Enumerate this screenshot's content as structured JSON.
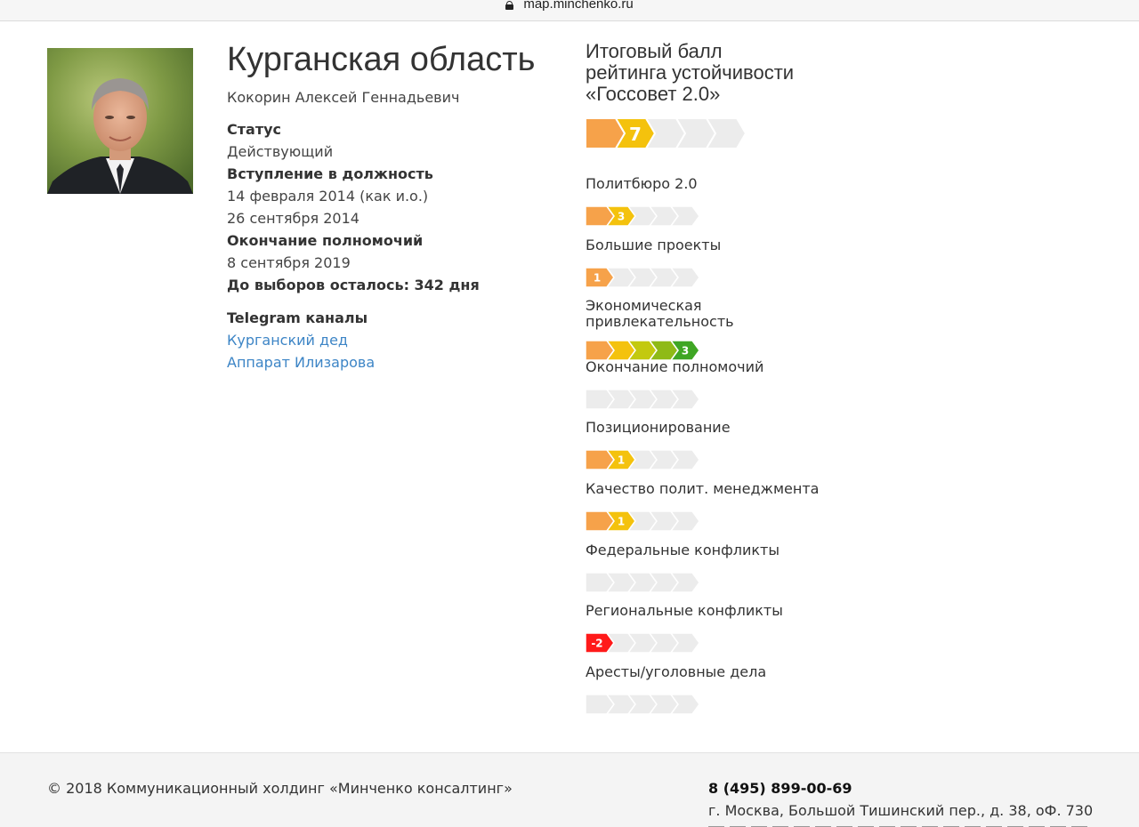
{
  "browser": {
    "url": "map.minchenko.ru"
  },
  "region": {
    "title": "Курганская область",
    "governor": "Кокорин Алексей Геннадьевич",
    "status_label": "Статус",
    "status_value": "Действующий",
    "start_label": "Вступление в должность",
    "start_value_1": "14 февраля 2014 (как и.о.)",
    "start_value_2": "26 сентября 2014",
    "end_label": "Окончание полномочий",
    "end_value": "8 сентября 2019",
    "elections_left": "До выборов осталось: 342 дня",
    "telegram_label": "Telegram каналы",
    "telegram_links": [
      "Курганский дед",
      "Аппарат Илизарова"
    ]
  },
  "total": {
    "title_lines": [
      "Итоговый балл",
      "рейтинга устойчивости",
      "«Госсовет 2.0»"
    ],
    "score": "7",
    "filled": 2
  },
  "criteria": [
    {
      "label": [
        "Политбюро 2.0"
      ],
      "score": "3",
      "filled": 2,
      "colors": [
        "#f6a24a",
        "#f4c20d"
      ]
    },
    {
      "label": [
        "Большие проекты"
      ],
      "score": "1",
      "filled": 1,
      "colors": [
        "#f6a24a"
      ]
    },
    {
      "label": [
        "Экономическая",
        "привлекательность"
      ],
      "score": "3",
      "filled": 5,
      "colors": [
        "#f6a24a",
        "#f4c20d",
        "#c3c90f",
        "#8fba17",
        "#3fa624"
      ]
    },
    {
      "label": [
        "Окончание полномочий"
      ],
      "score": "",
      "filled": 0,
      "colors": []
    },
    {
      "label": [
        "Позиционирование"
      ],
      "score": "1",
      "filled": 2,
      "colors": [
        "#f6a24a",
        "#f4c20d"
      ]
    },
    {
      "label": [
        "Качество полит. менеджмента"
      ],
      "score": "1",
      "filled": 2,
      "colors": [
        "#f6a24a",
        "#f4c20d"
      ]
    },
    {
      "label": [
        "Федеральные конфликты"
      ],
      "score": "",
      "filled": 0,
      "colors": []
    },
    {
      "label": [
        "Региональные конфликты"
      ],
      "score": "-2",
      "filled": 1,
      "colors": [
        "#ff1a1a"
      ]
    },
    {
      "label": [
        "Аресты/уголовные дела"
      ],
      "score": "",
      "filled": 0,
      "colors": []
    }
  ],
  "colors": {
    "empty_chevron": "#ececec",
    "link": "#3d85c6",
    "total_first": "#f6a24a",
    "total_second": "#f4c20d"
  },
  "footer": {
    "copyright": "© 2018 Коммуникационный холдинг «Минченко консалтинг»",
    "phone": "8 (495) 899-00-69",
    "address": "г. Москва, Большой Тишинский пер., д. 38, оФ. 730"
  }
}
